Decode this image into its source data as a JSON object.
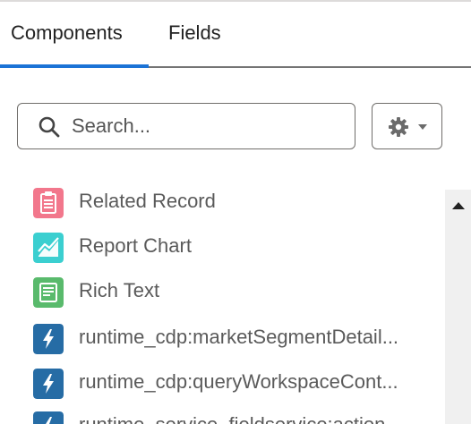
{
  "tabs": [
    {
      "label": "Components",
      "active": true
    },
    {
      "label": "Fields",
      "active": false
    }
  ],
  "search": {
    "placeholder": "Search...",
    "value": ""
  },
  "colors": {
    "accent": "#1b73d6",
    "related_record_icon": "#f2778c",
    "report_chart_icon": "#3bcfd0",
    "rich_text_icon": "#59ba6c",
    "lightning_icon": "#266ca5"
  },
  "components": [
    {
      "label": "Related Record",
      "icon": "related-record-icon"
    },
    {
      "label": "Report Chart",
      "icon": "report-chart-icon"
    },
    {
      "label": "Rich Text",
      "icon": "rich-text-icon"
    },
    {
      "label": "runtime_cdp:marketSegmentDetail...",
      "icon": "lightning-icon"
    },
    {
      "label": "runtime_cdp:queryWorkspaceCont...",
      "icon": "lightning-icon"
    },
    {
      "label": "runtime_service_fieldservice:action...",
      "icon": "lightning-icon"
    }
  ]
}
